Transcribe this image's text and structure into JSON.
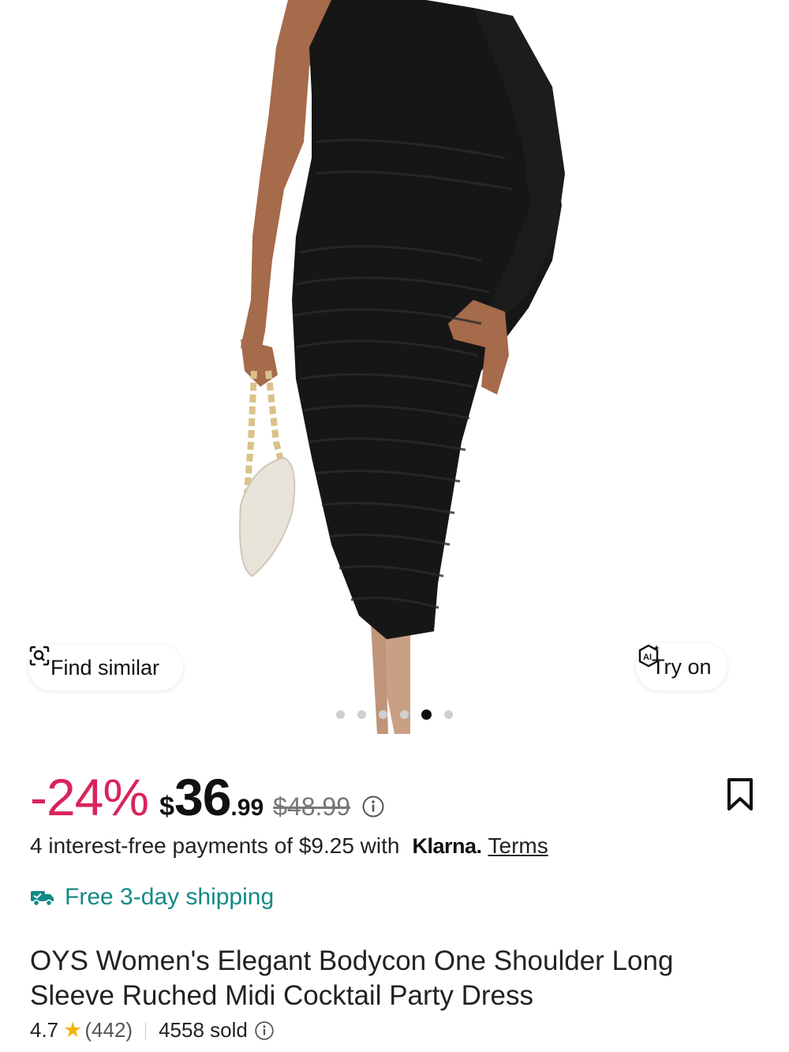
{
  "product_image": {
    "alt": "Black one-shoulder long sleeve ruched midi dress",
    "carousel": {
      "total": 6,
      "active_index": 4
    }
  },
  "actions": {
    "find_similar_label": "Find similar",
    "try_on_label": "Try on",
    "try_on_badge": "AI"
  },
  "price": {
    "discount": "-24%",
    "currency": "$",
    "whole": "36",
    "cents": ".99",
    "original": "$48.99"
  },
  "payment": {
    "text": "4 interest-free payments of $9.25 with",
    "provider": "Klarna.",
    "terms_label": "Terms"
  },
  "shipping": {
    "label": "Free 3-day shipping",
    "color": "#138a86"
  },
  "product": {
    "title": "OYS Women's Elegant Bodycon One Shoulder Long Sleeve Ruched Midi Cocktail Party Dress",
    "rating": "4.7",
    "review_count": "(442)",
    "sold": "4558 sold"
  },
  "colors": {
    "discount": "#d8245a",
    "star": "#f5b400"
  }
}
